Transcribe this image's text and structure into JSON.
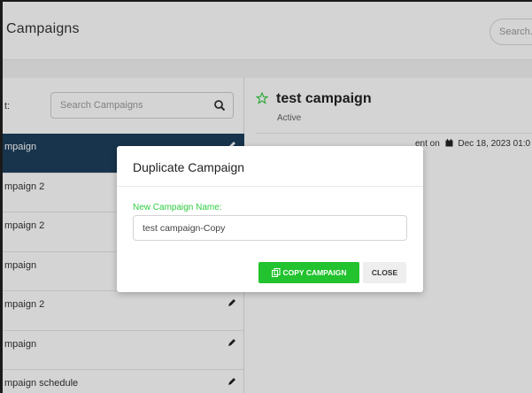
{
  "header": {
    "title": "Campaigns",
    "search_placeholder": "Search.."
  },
  "list_panel": {
    "filter_label": "t:",
    "search_placeholder": "Search Campaigns",
    "items": [
      {
        "label": "mpaign"
      },
      {
        "label": "mpaign 2"
      },
      {
        "label": "mpaign 2"
      },
      {
        "label": "mpaign"
      },
      {
        "label": "mpaign 2"
      },
      {
        "label": "mpaign"
      },
      {
        "label": "mpaign schedule"
      }
    ]
  },
  "detail": {
    "title": "test campaign",
    "status": "Active",
    "sent_prefix": "ent on",
    "sent_date": "Dec 18, 2023 01:0"
  },
  "modal": {
    "title": "Duplicate Campaign",
    "field_label": "New Campaign Name:",
    "field_value": "test campaign-Copy",
    "copy_button": "COPY CAMPAIGN",
    "close_button": "CLOSE"
  },
  "colors": {
    "accent_green": "#22c32e",
    "active_row": "#1c3f5c"
  }
}
